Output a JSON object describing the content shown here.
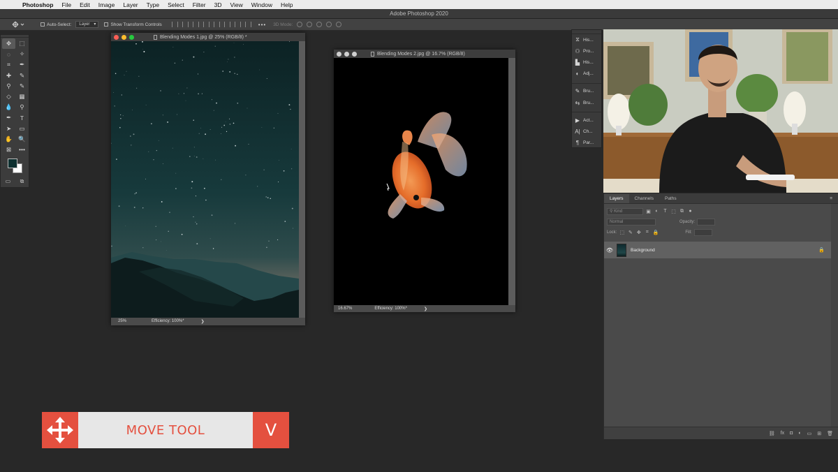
{
  "menubar": {
    "app_name": "Photoshop",
    "items": [
      "File",
      "Edit",
      "Image",
      "Layer",
      "Type",
      "Select",
      "Filter",
      "3D",
      "View",
      "Window",
      "Help"
    ]
  },
  "app_title": "Adobe Photoshop 2020",
  "options_bar": {
    "auto_select_label": "Auto-Select:",
    "auto_select_value": "Layer",
    "transform_controls_label": "Show Transform Controls",
    "mode_3d_label": "3D Mode:",
    "more_label": "•••"
  },
  "toolbar": {
    "tools": [
      "move",
      "marquee",
      "lasso",
      "magic-wand",
      "crop",
      "eyedropper",
      "healing-brush",
      "brush",
      "clone-stamp",
      "history-brush",
      "eraser",
      "gradient",
      "blur",
      "dodge",
      "pen",
      "type",
      "path-selection",
      "rectangle",
      "hand",
      "zoom",
      "frame",
      "edit-toolbar"
    ],
    "glyphs": [
      "✥",
      "⬚",
      "◌",
      "✧",
      "⌗",
      "✒",
      "✚",
      "✎",
      "⚲",
      "✎",
      "◇",
      "▦",
      "💧",
      "⚲",
      "✒",
      "T",
      "➤",
      "▭",
      "✋",
      "🔍",
      "⊠",
      "•••"
    ],
    "foreground_color": "#0e3030",
    "background_color": "#ffffff",
    "bottom_glyphs": [
      "▭",
      "⧉"
    ]
  },
  "doc1": {
    "title": "Blending Modes 1.jpg @ 25% (RGB/8) *",
    "zoom": "25%",
    "efficiency": "Efficiency: 100%*",
    "arrow": "❯"
  },
  "doc2": {
    "title": "Blending Modes 2.jpg @ 16.7% (RGB/8)",
    "zoom": "16.67%",
    "efficiency": "Efficiency: 100%*",
    "arrow": "❯"
  },
  "panel_strip": {
    "group1": [
      {
        "icon": "⧖",
        "label": "His..."
      },
      {
        "icon": "⚇",
        "label": "Pro..."
      },
      {
        "icon": "▙",
        "label": "His..."
      },
      {
        "icon": "◐",
        "label": "Adj..."
      }
    ],
    "group2": [
      {
        "icon": "✎",
        "label": "Bru..."
      },
      {
        "icon": "⇆",
        "label": "Bru..."
      }
    ],
    "group3": [
      {
        "icon": "▶",
        "label": "Act..."
      },
      {
        "icon": "A|",
        "label": "Ch..."
      },
      {
        "icon": "¶",
        "label": "Par..."
      }
    ]
  },
  "layers_panel": {
    "tabs": [
      "Layers",
      "Channels",
      "Paths"
    ],
    "active_tab": "Layers",
    "menu_icon": "≡",
    "filter_placeholder": "Kind",
    "blend_mode": "Normal",
    "opacity_label": "Opacity:",
    "lock_label": "Lock:",
    "fill_label": "Fill:",
    "filter_icons": [
      "▣",
      "◐",
      "T",
      "⬚",
      "⧉",
      "●"
    ],
    "lock_icons": [
      "⬚",
      "✎",
      "✥",
      "⌗",
      "🔒"
    ],
    "layer_name": "Background",
    "eye": "👁",
    "lock": "🔒",
    "footer_icons": [
      "⛓",
      "fx",
      "◘",
      "◐",
      "▭",
      "⊞",
      "🗑"
    ]
  },
  "caption": {
    "label": "MOVE TOOL",
    "shortcut": "V",
    "accent": "#e4503f"
  }
}
